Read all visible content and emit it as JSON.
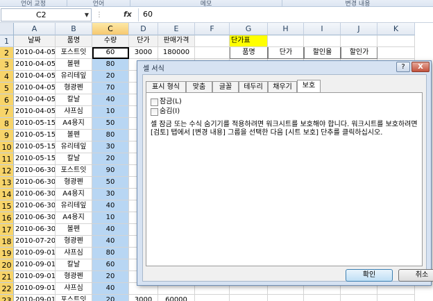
{
  "ribbon": {
    "groups": [
      "언어 교정",
      "언어",
      "메모",
      "변경 내용"
    ]
  },
  "formula_bar": {
    "name_box": "C2",
    "fx": "fx",
    "value": "60"
  },
  "columns": [
    "A",
    "B",
    "C",
    "D",
    "E",
    "F",
    "G",
    "H",
    "I",
    "J",
    "K"
  ],
  "rows": [
    {
      "n": "1",
      "a": "날짜",
      "b": "품명",
      "c": "수량",
      "d": "단가",
      "e": "판매가격",
      "g": "단가표"
    },
    {
      "n": "2",
      "a": "2010-04-05",
      "b": "포스트잇",
      "c": "60",
      "d": "3000",
      "e": "180000",
      "g": "품명",
      "h": "단가",
      "i": "할인율",
      "j": "할인가"
    },
    {
      "n": "3",
      "a": "2010-04-05",
      "b": "볼펜",
      "c": "80"
    },
    {
      "n": "4",
      "a": "2010-04-05",
      "b": "유리테잎",
      "c": "20"
    },
    {
      "n": "5",
      "a": "2010-04-05",
      "b": "형광펜",
      "c": "70"
    },
    {
      "n": "6",
      "a": "2010-04-05",
      "b": "칼날",
      "c": "40"
    },
    {
      "n": "7",
      "a": "2010-04-05",
      "b": "샤프심",
      "c": "10"
    },
    {
      "n": "8",
      "a": "2010-05-15",
      "b": "A4용지",
      "c": "50"
    },
    {
      "n": "9",
      "a": "2010-05-15",
      "b": "볼펜",
      "c": "80"
    },
    {
      "n": "10",
      "a": "2010-05-15",
      "b": "유리테잎",
      "c": "30"
    },
    {
      "n": "11",
      "a": "2010-05-15",
      "b": "칼날",
      "c": "20"
    },
    {
      "n": "12",
      "a": "2010-06-30",
      "b": "포스트잇",
      "c": "90"
    },
    {
      "n": "13",
      "a": "2010-06-30",
      "b": "형광펜",
      "c": "50"
    },
    {
      "n": "14",
      "a": "2010-06-30",
      "b": "A4용지",
      "c": "30"
    },
    {
      "n": "15",
      "a": "2010-06-30",
      "b": "유리테잎",
      "c": "40"
    },
    {
      "n": "16",
      "a": "2010-06-30",
      "b": "A4용지",
      "c": "10"
    },
    {
      "n": "17",
      "a": "2010-06-30",
      "b": "볼펜",
      "c": "40"
    },
    {
      "n": "18",
      "a": "2010-07-20",
      "b": "형광펜",
      "c": "40"
    },
    {
      "n": "19",
      "a": "2010-09-01",
      "b": "샤프심",
      "c": "80"
    },
    {
      "n": "20",
      "a": "2010-09-01",
      "b": "칼날",
      "c": "60"
    },
    {
      "n": "21",
      "a": "2010-09-01",
      "b": "형광펜",
      "c": "20"
    },
    {
      "n": "22",
      "a": "2010-09-01",
      "b": "샤프심",
      "c": "40"
    },
    {
      "n": "23",
      "a": "2010-09-01",
      "b": "포스트잇",
      "c": "20",
      "d": "3000",
      "e": "60000"
    }
  ],
  "dialog": {
    "title": "셀 서식",
    "help": "?",
    "close": "X",
    "tabs": [
      "표시 형식",
      "맞춤",
      "글꼴",
      "테두리",
      "채우기",
      "보호"
    ],
    "active_tab": "보호",
    "locked_label": "잠금(L)",
    "hidden_label": "숨김(I)",
    "note": "셀 잠금 또는 수식 숨기기를 적용하려면 워크시트를 보호해야 합니다. 워크시트를 보호하려면 [검토] 탭에서 [변경 내용] 그룹을 선택한 다음 [시트 보호] 단추를 클릭하십시오.",
    "ok": "확인",
    "cancel": "취소"
  },
  "colors": {
    "selected_column": "#b8d6f3",
    "yellow_label": "#ffff00",
    "dialog_frame": "#d6e2f2"
  }
}
